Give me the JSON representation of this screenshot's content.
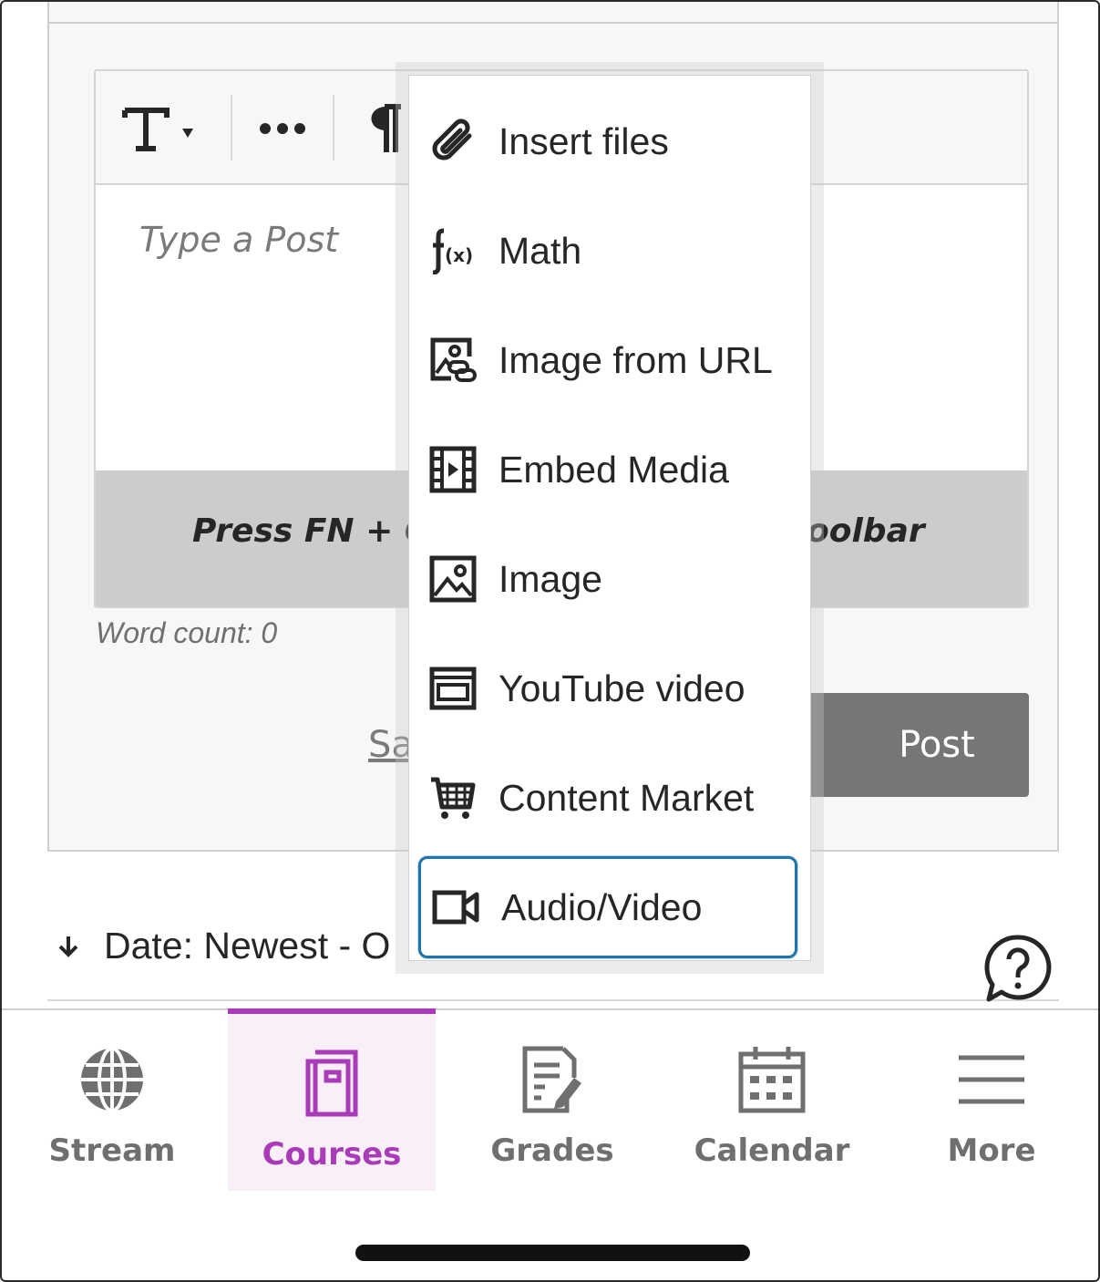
{
  "editor": {
    "placeholder": "Type a Post",
    "hint_left": "Press FN + C",
    "hint_right": "oolbar",
    "word_count": "Word count: 0",
    "save_label": "Sa",
    "post_label": "Post"
  },
  "toolbar": {
    "text_style_icon": "text-style-icon",
    "more_icon": "ellipsis-icon",
    "paragraph_icon": "pilcrow-icon"
  },
  "menu": {
    "items": [
      {
        "label": "Insert files",
        "icon": "paperclip-icon"
      },
      {
        "label": "Math",
        "icon": "function-icon"
      },
      {
        "label": "Image from URL",
        "icon": "image-link-icon"
      },
      {
        "label": "Embed Media",
        "icon": "film-icon"
      },
      {
        "label": "Image",
        "icon": "image-icon"
      },
      {
        "label": "YouTube video",
        "icon": "video-frame-icon"
      },
      {
        "label": "Content Market",
        "icon": "cart-icon"
      },
      {
        "label": "Audio/Video",
        "icon": "video-camera-icon"
      }
    ],
    "focused_index": 7
  },
  "sort": {
    "label": "Date: Newest - O"
  },
  "nav": {
    "items": [
      {
        "label": "Stream",
        "icon": "globe-icon"
      },
      {
        "label": "Courses",
        "icon": "book-icon"
      },
      {
        "label": "Grades",
        "icon": "grades-icon"
      },
      {
        "label": "Calendar",
        "icon": "calendar-icon"
      },
      {
        "label": "More",
        "icon": "menu-icon"
      }
    ],
    "active": "Courses"
  },
  "colors": {
    "accent": "#a93bb9",
    "focus": "#1f75a8",
    "post_button": "#767676",
    "hint_bar": "#cccccc"
  }
}
